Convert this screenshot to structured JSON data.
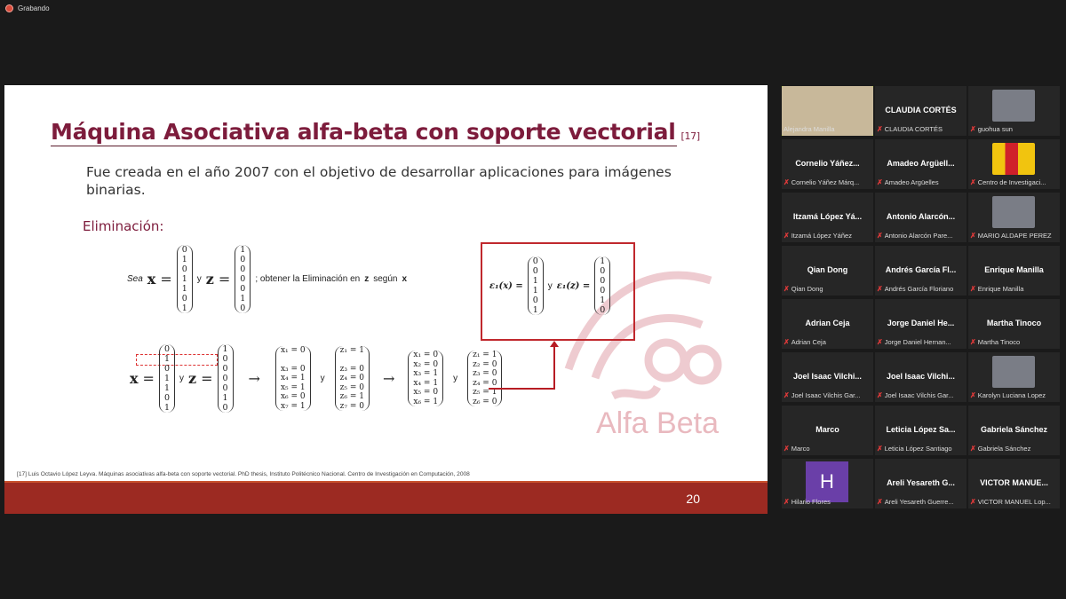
{
  "recording": {
    "label": "Grabando"
  },
  "slide": {
    "title": "Máquina Asociativa alfa-beta con soporte vectorial",
    "title_ref": "[17]",
    "intro": "Fue creada en el año 2007 con el objetivo de desarrollar aplicaciones para imágenes binarias.",
    "subheading": "Eliminación:",
    "sea": "Sea",
    "x": "x",
    "z": "z",
    "y_word": "y",
    "obtain_text": "; obtener la Eliminación en",
    "segun": "según",
    "x_vec": [
      "0",
      "1",
      "0",
      "1",
      "1",
      "0",
      "1"
    ],
    "z_vec": [
      "1",
      "0",
      "0",
      "0",
      "0",
      "1",
      "0"
    ],
    "eps_x": "ε₁(x) =",
    "eps_z": "ε₁(z) =",
    "eps_x_vec": [
      "0",
      "0",
      "1",
      "1",
      "0",
      "1"
    ],
    "eps_z_vec": [
      "1",
      "0",
      "0",
      "0",
      "1",
      "0"
    ],
    "x_assign": [
      "x₁ = 0",
      "",
      "x₃ = 0",
      "x₄ = 1",
      "x₅ = 1",
      "x₆ = 0",
      "x₇ = 1"
    ],
    "z_assign": [
      "z₁ = 1",
      "",
      "z₃ = 0",
      "z₄ = 0",
      "z₅ = 0",
      "z₆ = 1",
      "z₇ = 0"
    ],
    "x_new": [
      "x₁ = 0",
      "x₂ = 0",
      "x₃ = 1",
      "x₄ = 1",
      "x₅ = 0",
      "x₆ = 1"
    ],
    "z_new": [
      "z₁ = 1",
      "z₂ = 0",
      "z₃ = 0",
      "z₄ = 0",
      "z₅ = 1",
      "z₆ = 0"
    ],
    "arrow": "→",
    "eq": "=",
    "logo_text": "Alfa Beta",
    "footnote": "[17] Luis Octavio López Leyva. Máquinas asociativas alfa-beta con soporte vectorial. PhD thesis, Instituto Politécnico Nacional. Centro de Investigación en Computación, 2008",
    "page_number": "20"
  },
  "participants": [
    {
      "name": "",
      "label": "Alejandra Manilla",
      "video": true,
      "active": true
    },
    {
      "name": "CLAUDIA CORTÉS",
      "label": "CLAUDIA CORTÉS"
    },
    {
      "name": "",
      "label": "guohua sun",
      "video": true
    },
    {
      "name": "Cornelio Yáñez...",
      "label": "Cornelio Yáñez Márq..."
    },
    {
      "name": "Amadeo Argüell...",
      "label": "Amadeo Argüelles"
    },
    {
      "name": "",
      "label": "Centro de Investigaci...",
      "logo": true
    },
    {
      "name": "Itzamá López Yá...",
      "label": "Itzamá López Yáñez"
    },
    {
      "name": "Antonio Alarcón...",
      "label": "Antonio Alarcón Pare..."
    },
    {
      "name": "",
      "label": "MARIO ALDAPE PEREZ",
      "video": true
    },
    {
      "name": "Qian Dong",
      "label": "Qian Dong"
    },
    {
      "name": "Andrés García Fl...",
      "label": "Andrés García Floriano"
    },
    {
      "name": "Enrique Manilla",
      "label": "Enrique Manilla"
    },
    {
      "name": "Adrian Ceja",
      "label": "Adrian Ceja"
    },
    {
      "name": "Jorge Daniel He...",
      "label": "Jorge Daniel Hernan..."
    },
    {
      "name": "Martha Tinoco",
      "label": "Martha Tinoco"
    },
    {
      "name": "Joel Isaac Vilchi...",
      "label": "Joel Isaac Vilchis Gar..."
    },
    {
      "name": "Joel Isaac Vilchi...",
      "label": "Joel Isaac Vilchis Gar..."
    },
    {
      "name": "",
      "label": "Karolyn Luciana Lopez",
      "video": true
    },
    {
      "name": "Marco",
      "label": "Marco"
    },
    {
      "name": "Leticia López Sa...",
      "label": "Leticia López Santiago"
    },
    {
      "name": "Gabriela Sánchez",
      "label": "Gabriela Sánchez"
    },
    {
      "name": "",
      "label": "Hilario Flores",
      "avatar_letter": "H",
      "avatar_color": "#6a3fa8"
    },
    {
      "name": "Areli Yesareth G...",
      "label": "Areli Yesareth Guerre..."
    },
    {
      "name": "VICTOR MANUE...",
      "label": "VICTOR MANUEL Lop..."
    }
  ],
  "colors": {
    "title": "#7d1c3c",
    "footer": "#9c2a22",
    "box": "#c0282d",
    "active_border": "#b7e33a"
  }
}
